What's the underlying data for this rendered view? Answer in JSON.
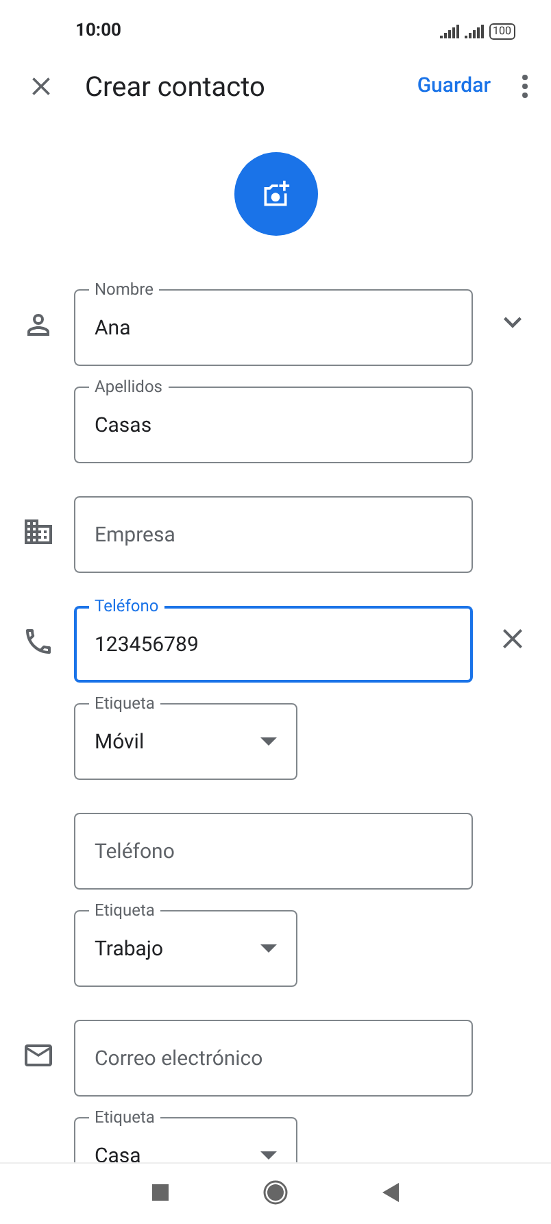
{
  "status_bar": {
    "time": "10:00",
    "battery": "100"
  },
  "header": {
    "title": "Crear contacto",
    "save": "Guardar"
  },
  "sections": [
    {
      "trailing": {
        "kind": "expand"
      },
      "fields": [
        {
          "kind": "text",
          "label": "Nombre",
          "value": "Ana",
          "focused": false
        },
        {
          "kind": "text",
          "label": "Apellidos",
          "value": "Casas",
          "focused": false
        }
      ]
    },
    {
      "fields": [
        {
          "kind": "text",
          "placeholder": "Empresa",
          "focused": false
        }
      ]
    },
    {
      "trailing": {
        "kind": "clear"
      },
      "fields": [
        {
          "kind": "text",
          "label": "Teléfono",
          "value": "123456789",
          "focused": true
        },
        {
          "kind": "dropdown",
          "label": "Etiqueta",
          "value": "Móvil",
          "focused": false
        }
      ]
    },
    {
      "fields": [
        {
          "kind": "text",
          "placeholder": "Teléfono",
          "focused": false
        },
        {
          "kind": "dropdown",
          "label": "Etiqueta",
          "value": "Trabajo",
          "focused": false
        }
      ]
    },
    {
      "fields": [
        {
          "kind": "text",
          "placeholder": "Correo electrónico",
          "focused": false
        },
        {
          "kind": "dropdown",
          "label": "Etiqueta",
          "value": "Casa",
          "focused": false
        }
      ]
    }
  ]
}
